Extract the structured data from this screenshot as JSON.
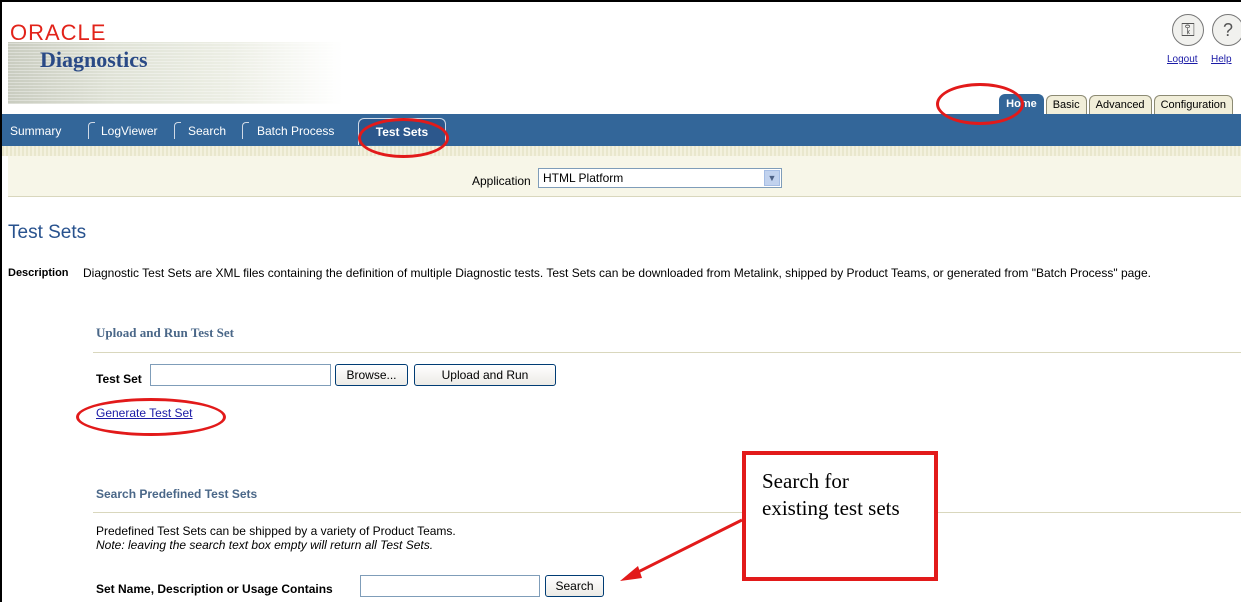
{
  "brand": {
    "oracle": "ORACLE",
    "product": "Diagnostics"
  },
  "global": {
    "logout": "Logout",
    "help": "Help"
  },
  "top_tabs": [
    "Home",
    "Basic",
    "Advanced",
    "Configuration"
  ],
  "nav": {
    "items": [
      "Summary",
      "LogViewer",
      "Search",
      "Batch Process"
    ],
    "active": "Test Sets"
  },
  "application": {
    "label": "Application",
    "selected": "HTML Platform"
  },
  "page_title": "Test Sets",
  "description": {
    "label": "Description",
    "text": "Diagnostic Test Sets are XML files containing the definition of multiple Diagnostic tests. Test Sets can be downloaded from Metalink, shipped by Product Teams, or generated from \"Batch Process\" page."
  },
  "upload": {
    "heading": "Upload and Run Test Set",
    "label": "Test Set",
    "value": "",
    "browse": "Browse...",
    "run": "Upload and Run",
    "generate_link": "Generate Test Set"
  },
  "search": {
    "heading": "Search Predefined Test Sets",
    "info": "Predefined Test Sets can be shipped by a variety of Product Teams.",
    "note": "Note: leaving the search text box empty will return all Test Sets.",
    "label": "Set Name, Description or Usage Contains",
    "value": "",
    "button": "Search"
  },
  "callout": {
    "text": "Search for existing test sets"
  },
  "colors": {
    "highlight": "#e21a1a",
    "nav": "#336699",
    "oracle_red": "#e2231a"
  }
}
